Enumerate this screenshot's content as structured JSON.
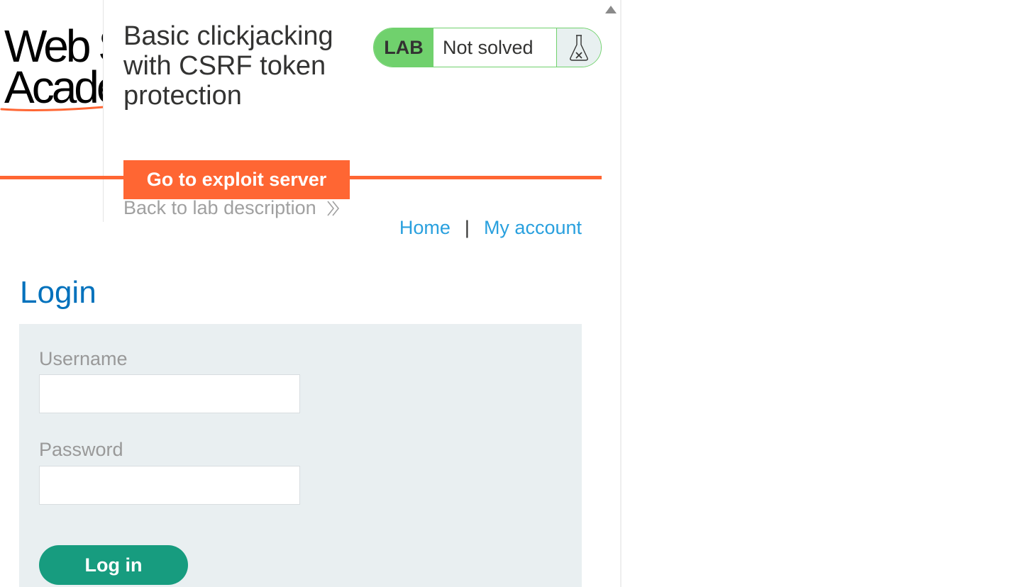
{
  "header": {
    "logo": {
      "line1": "Web Security",
      "line2": "Academy"
    },
    "lab_title": "Basic clickjacking with CSRF token protection",
    "exploit_button": "Go to exploit server",
    "back_link": "Back to lab description"
  },
  "status": {
    "badge": "LAB",
    "text": "Not solved",
    "icon": "flask-icon"
  },
  "nav": {
    "home": "Home",
    "separator": "|",
    "account": "My account"
  },
  "login": {
    "heading": "Login",
    "username_label": "Username",
    "username_value": "",
    "password_label": "Password",
    "password_value": "",
    "submit_label": "Log in"
  },
  "colors": {
    "accent_orange": "#ff6633",
    "status_green": "#70d16d",
    "link_blue": "#29a0de",
    "heading_blue": "#0071bc",
    "button_teal": "#179c7f"
  }
}
